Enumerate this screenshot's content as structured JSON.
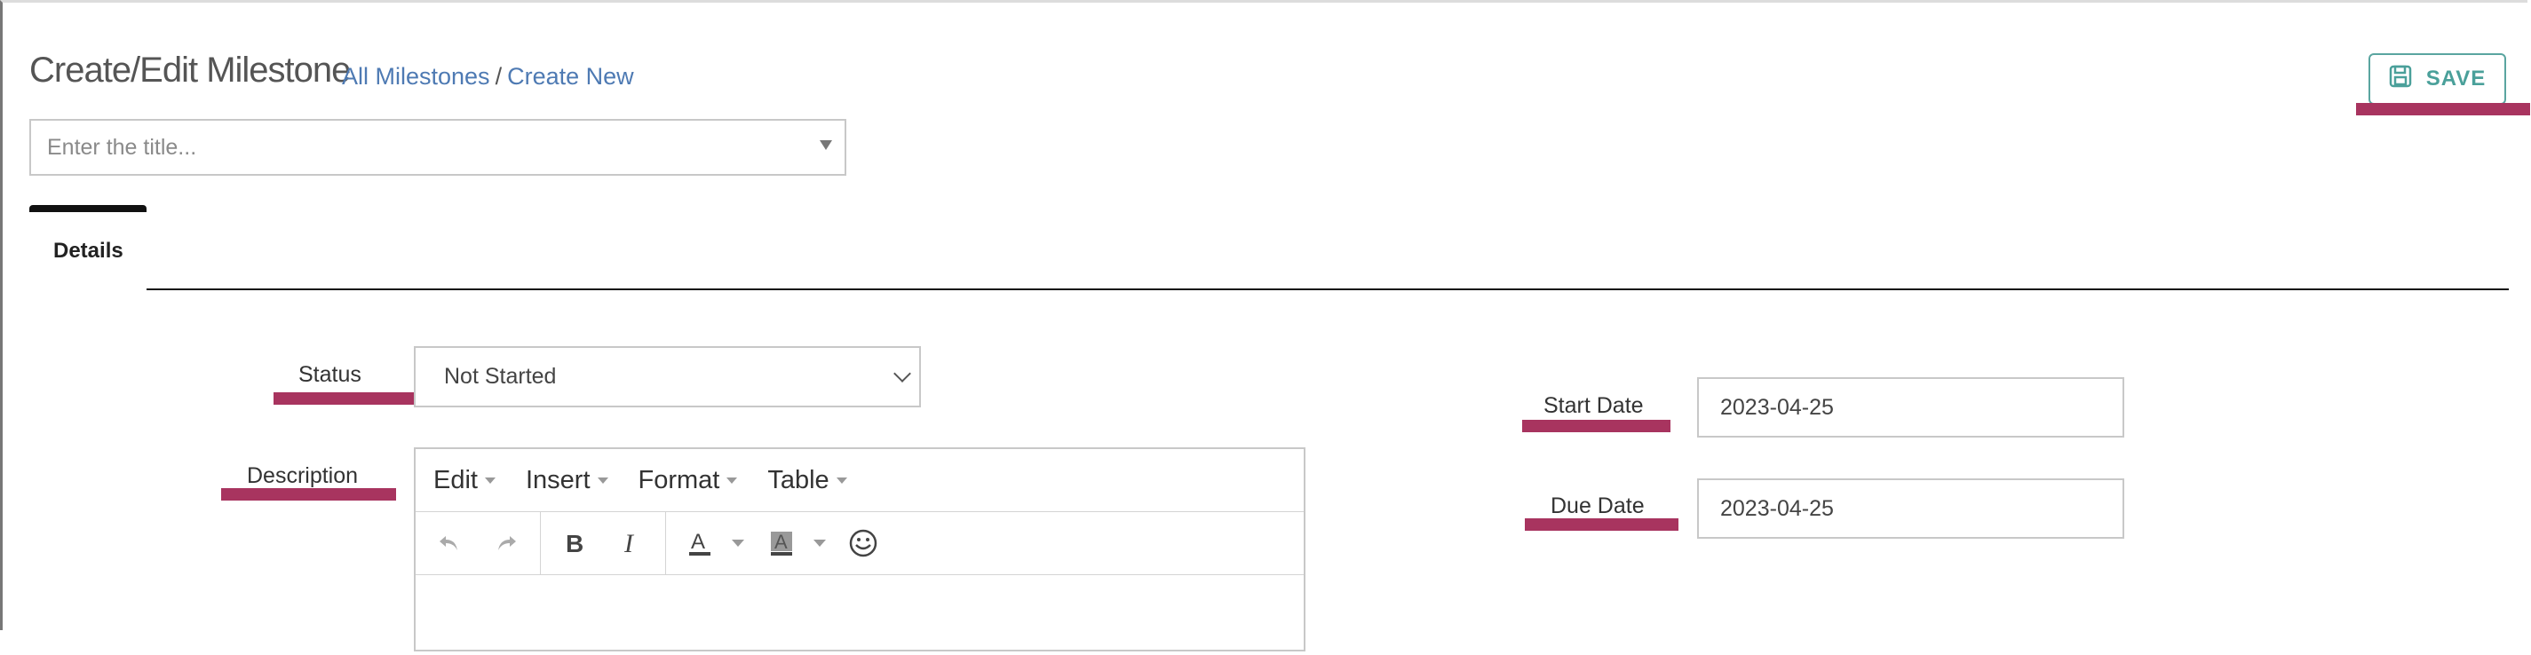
{
  "header": {
    "title": "Create/Edit Milestone",
    "breadcrumb": {
      "all": "All Milestones",
      "separator": "/",
      "current": "Create New"
    },
    "save_label": "SAVE",
    "save_icon": "floppy-disk-icon"
  },
  "title_field": {
    "placeholder": "Enter the title..."
  },
  "tabs": [
    {
      "label": "Details",
      "active": true
    }
  ],
  "form": {
    "status": {
      "label": "Status",
      "value": "Not Started"
    },
    "description": {
      "label": "Description",
      "menu": [
        "Edit",
        "Insert",
        "Format",
        "Table"
      ],
      "toolbar_icons": [
        "undo-icon",
        "redo-icon",
        "bold-icon",
        "italic-icon",
        "text-color-icon",
        "background-color-icon",
        "emoticon-icon"
      ]
    },
    "start_date": {
      "label": "Start Date",
      "value": "2023-04-25"
    },
    "due_date": {
      "label": "Due Date",
      "value": "2023-04-25"
    }
  },
  "colors": {
    "accent_teal": "#4aa09a",
    "link_blue": "#4e7ab3",
    "annotation_mark": "#a8345f"
  }
}
